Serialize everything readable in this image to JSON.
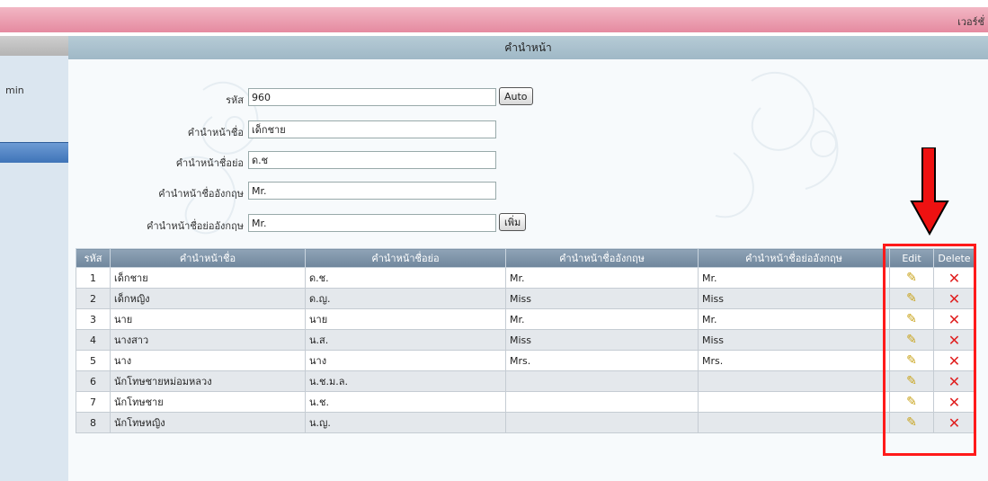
{
  "header": {
    "version_text": "เวอร์ชั่"
  },
  "sidebar": {
    "text": "min"
  },
  "section": {
    "title": "คำนำหน้า"
  },
  "form": {
    "code_label": "รหัส",
    "code_value": "960",
    "auto_button": "Auto",
    "prefix_label": "คำนำหน้าชื่อ",
    "prefix_value": "เด็กชาย",
    "prefix_abbr_label": "คำนำหน้าชื่อย่อ",
    "prefix_abbr_value": "ด.ช",
    "prefix_en_label": "คำนำหน้าชื่ออังกฤษ",
    "prefix_en_value": "Mr.",
    "prefix_abbr_en_label": "คำนำหน้าชื่อย่ออังกฤษ",
    "prefix_abbr_en_value": "Mr.",
    "add_button": "เพิ่ม"
  },
  "table": {
    "headers": [
      "รหัส",
      "คำนำหน้าชื่อ",
      "คำนำหน้าชื่อย่อ",
      "คำนำหน้าชื่ออังกฤษ",
      "คำนำหน้าชื่อย่ออังกฤษ",
      "Edit",
      "Delete"
    ],
    "rows": [
      [
        "1",
        "เด็กชาย",
        "ด.ช.",
        "Mr.",
        "Mr."
      ],
      [
        "2",
        "เด็กหญิง",
        "ด.ญ.",
        "Miss",
        "Miss"
      ],
      [
        "3",
        "นาย",
        "นาย",
        "Mr.",
        "Mr."
      ],
      [
        "4",
        "นางสาว",
        "น.ส.",
        "Miss",
        "Miss"
      ],
      [
        "5",
        "นาง",
        "นาง",
        "Mrs.",
        "Mrs."
      ],
      [
        "6",
        "นักโทษชายหม่อมหลวง",
        "น.ช.ม.ล.",
        "",
        ""
      ],
      [
        "7",
        "นักโทษชาย",
        "น.ช.",
        "",
        ""
      ],
      [
        "8",
        "นักโทษหญิง",
        "น.ญ.",
        "",
        ""
      ]
    ],
    "edit_icon": "pencil-icon",
    "delete_icon": "red-x-icon"
  },
  "colors": {
    "highlight": "#ff1a1a",
    "arrow": "#ee1111",
    "header_bg": "#e58aa0"
  }
}
